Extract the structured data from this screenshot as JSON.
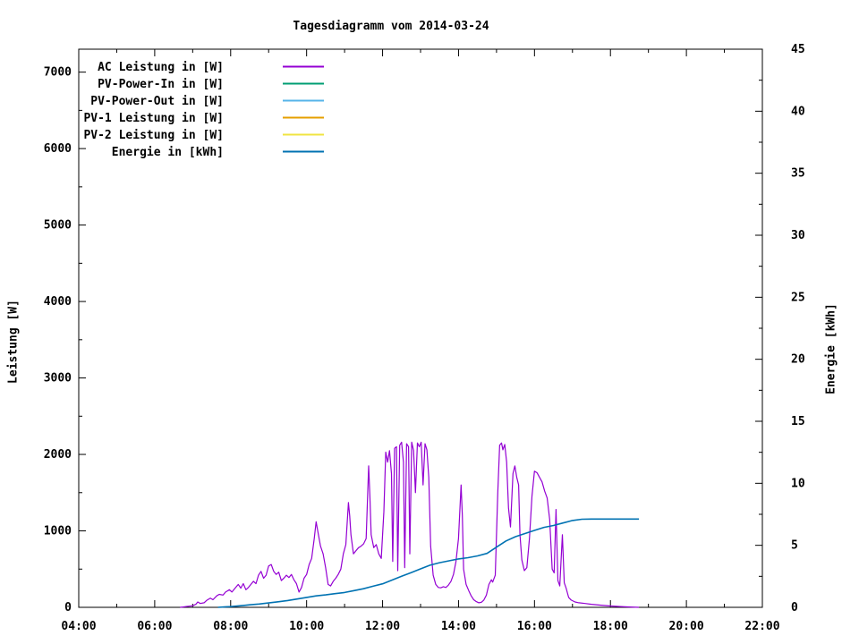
{
  "chart_data": {
    "type": "line",
    "title": "Tagesdiagramm vom 2014-03-24",
    "grid": false,
    "legend_position": "top-left-inside",
    "x_axis": {
      "label": "",
      "range_hours": [
        4,
        22
      ],
      "major_tick_labels": [
        "04:00",
        "06:00",
        "08:00",
        "10:00",
        "12:00",
        "14:00",
        "16:00",
        "18:00",
        "20:00",
        "22:00"
      ],
      "minor_every_hours": 1
    },
    "y_left": {
      "label": "Leistung [W]",
      "range": [
        0,
        7300
      ],
      "ticks": [
        0,
        1000,
        2000,
        3000,
        4000,
        5000,
        6000,
        7000
      ],
      "minor_step": 500
    },
    "y_right": {
      "label": "Energie [kWh]",
      "range": [
        0,
        45
      ],
      "ticks": [
        0,
        5,
        10,
        15,
        20,
        25,
        30,
        35,
        40,
        45
      ],
      "minor_step": 2.5
    },
    "legend": [
      {
        "label": "AC Leistung in [W]",
        "color": "#9400d3"
      },
      {
        "label": "PV-Power-In in [W]",
        "color": "#009e73"
      },
      {
        "label": "PV-Power-Out in [W]",
        "color": "#56b4e9"
      },
      {
        "label": "PV-1 Leistung in [W]",
        "color": "#e69f00"
      },
      {
        "label": "PV-2 Leistung in [W]",
        "color": "#f0e442"
      },
      {
        "label": "Energie in [kWh]",
        "color": "#0072b2"
      }
    ],
    "series": [
      {
        "id": "ac-leistung",
        "name": "AC Leistung in [W]",
        "axis": "left",
        "color": "#9400d3",
        "width": 1.2,
        "points": [
          [
            "06:40",
            0
          ],
          [
            "06:45",
            5
          ],
          [
            "06:50",
            10
          ],
          [
            "06:55",
            15
          ],
          [
            "07:00",
            20
          ],
          [
            "07:05",
            40
          ],
          [
            "07:08",
            70
          ],
          [
            "07:12",
            50
          ],
          [
            "07:18",
            60
          ],
          [
            "07:22",
            90
          ],
          [
            "07:28",
            120
          ],
          [
            "07:32",
            100
          ],
          [
            "07:38",
            150
          ],
          [
            "07:42",
            170
          ],
          [
            "07:48",
            160
          ],
          [
            "07:52",
            200
          ],
          [
            "07:58",
            230
          ],
          [
            "08:02",
            200
          ],
          [
            "08:08",
            260
          ],
          [
            "08:12",
            300
          ],
          [
            "08:16",
            250
          ],
          [
            "08:20",
            310
          ],
          [
            "08:24",
            230
          ],
          [
            "08:28",
            260
          ],
          [
            "08:32",
            300
          ],
          [
            "08:36",
            340
          ],
          [
            "08:40",
            310
          ],
          [
            "08:44",
            420
          ],
          [
            "08:48",
            470
          ],
          [
            "08:52",
            380
          ],
          [
            "08:56",
            420
          ],
          [
            "09:00",
            540
          ],
          [
            "09:04",
            560
          ],
          [
            "09:08",
            470
          ],
          [
            "09:12",
            430
          ],
          [
            "09:16",
            460
          ],
          [
            "09:20",
            350
          ],
          [
            "09:24",
            380
          ],
          [
            "09:28",
            420
          ],
          [
            "09:32",
            390
          ],
          [
            "09:36",
            430
          ],
          [
            "09:40",
            360
          ],
          [
            "09:44",
            310
          ],
          [
            "09:48",
            200
          ],
          [
            "09:52",
            260
          ],
          [
            "09:56",
            380
          ],
          [
            "10:00",
            430
          ],
          [
            "10:04",
            560
          ],
          [
            "10:08",
            640
          ],
          [
            "10:12",
            900
          ],
          [
            "10:15",
            1120
          ],
          [
            "10:18",
            980
          ],
          [
            "10:22",
            800
          ],
          [
            "10:26",
            700
          ],
          [
            "10:30",
            520
          ],
          [
            "10:34",
            300
          ],
          [
            "10:38",
            280
          ],
          [
            "10:42",
            340
          ],
          [
            "10:46",
            380
          ],
          [
            "10:50",
            430
          ],
          [
            "10:54",
            500
          ],
          [
            "10:58",
            700
          ],
          [
            "11:02",
            820
          ],
          [
            "11:06",
            1370
          ],
          [
            "11:08",
            1200
          ],
          [
            "11:10",
            950
          ],
          [
            "11:14",
            700
          ],
          [
            "11:18",
            740
          ],
          [
            "11:22",
            780
          ],
          [
            "11:26",
            800
          ],
          [
            "11:30",
            830
          ],
          [
            "11:34",
            900
          ],
          [
            "11:38",
            1850
          ],
          [
            "11:40",
            1450
          ],
          [
            "11:42",
            950
          ],
          [
            "11:46",
            780
          ],
          [
            "11:50",
            820
          ],
          [
            "11:54",
            700
          ],
          [
            "11:58",
            640
          ],
          [
            "12:02",
            1250
          ],
          [
            "12:05",
            2030
          ],
          [
            "12:08",
            1900
          ],
          [
            "12:11",
            2050
          ],
          [
            "12:14",
            1750
          ],
          [
            "12:16",
            600
          ],
          [
            "12:19",
            2080
          ],
          [
            "12:22",
            2100
          ],
          [
            "12:24",
            480
          ],
          [
            "12:27",
            2120
          ],
          [
            "12:30",
            2160
          ],
          [
            "12:33",
            1900
          ],
          [
            "12:35",
            520
          ],
          [
            "12:38",
            2140
          ],
          [
            "12:41",
            2100
          ],
          [
            "12:43",
            700
          ],
          [
            "12:46",
            2160
          ],
          [
            "12:49",
            2050
          ],
          [
            "12:52",
            1500
          ],
          [
            "12:55",
            2150
          ],
          [
            "12:58",
            2100
          ],
          [
            "13:01",
            2160
          ],
          [
            "13:04",
            1600
          ],
          [
            "13:07",
            2140
          ],
          [
            "13:10",
            2060
          ],
          [
            "13:13",
            1700
          ],
          [
            "13:16",
            800
          ],
          [
            "13:20",
            420
          ],
          [
            "13:24",
            300
          ],
          [
            "13:28",
            260
          ],
          [
            "13:32",
            255
          ],
          [
            "13:36",
            270
          ],
          [
            "13:40",
            260
          ],
          [
            "13:44",
            290
          ],
          [
            "13:48",
            340
          ],
          [
            "13:52",
            430
          ],
          [
            "13:56",
            600
          ],
          [
            "14:00",
            900
          ],
          [
            "14:04",
            1600
          ],
          [
            "14:06",
            1200
          ],
          [
            "14:08",
            500
          ],
          [
            "14:12",
            300
          ],
          [
            "14:16",
            220
          ],
          [
            "14:20",
            150
          ],
          [
            "14:24",
            100
          ],
          [
            "14:28",
            75
          ],
          [
            "14:32",
            60
          ],
          [
            "14:36",
            65
          ],
          [
            "14:40",
            95
          ],
          [
            "14:44",
            160
          ],
          [
            "14:48",
            300
          ],
          [
            "14:52",
            360
          ],
          [
            "14:54",
            330
          ],
          [
            "14:58",
            420
          ],
          [
            "15:02",
            1500
          ],
          [
            "15:05",
            2120
          ],
          [
            "15:08",
            2150
          ],
          [
            "15:10",
            2060
          ],
          [
            "15:13",
            2130
          ],
          [
            "15:16",
            1900
          ],
          [
            "15:19",
            1300
          ],
          [
            "15:22",
            1050
          ],
          [
            "15:26",
            1750
          ],
          [
            "15:29",
            1850
          ],
          [
            "15:32",
            1700
          ],
          [
            "15:35",
            1600
          ],
          [
            "15:37",
            950
          ],
          [
            "15:40",
            620
          ],
          [
            "15:44",
            480
          ],
          [
            "15:48",
            520
          ],
          [
            "15:52",
            900
          ],
          [
            "15:56",
            1450
          ],
          [
            "16:00",
            1780
          ],
          [
            "16:04",
            1760
          ],
          [
            "16:08",
            1700
          ],
          [
            "16:12",
            1640
          ],
          [
            "16:16",
            1520
          ],
          [
            "16:20",
            1430
          ],
          [
            "16:24",
            1150
          ],
          [
            "16:28",
            500
          ],
          [
            "16:31",
            450
          ],
          [
            "16:34",
            1280
          ],
          [
            "16:37",
            350
          ],
          [
            "16:40",
            280
          ],
          [
            "16:44",
            950
          ],
          [
            "16:47",
            320
          ],
          [
            "16:50",
            250
          ],
          [
            "16:54",
            130
          ],
          [
            "16:58",
            95
          ],
          [
            "17:04",
            70
          ],
          [
            "17:10",
            60
          ],
          [
            "17:20",
            50
          ],
          [
            "17:30",
            40
          ],
          [
            "17:45",
            28
          ],
          [
            "18:00",
            18
          ],
          [
            "18:15",
            10
          ],
          [
            "18:30",
            5
          ],
          [
            "18:45",
            0
          ]
        ]
      },
      {
        "id": "pv-power-in",
        "name": "PV-Power-In in [W]",
        "axis": "left",
        "color": "#009e73",
        "width": 1.2,
        "points": []
      },
      {
        "id": "pv-power-out",
        "name": "PV-Power-Out in [W]",
        "axis": "left",
        "color": "#56b4e9",
        "width": 1.2,
        "points": []
      },
      {
        "id": "pv-1-leistung",
        "name": "PV-1 Leistung in [W]",
        "axis": "left",
        "color": "#e69f00",
        "width": 1.2,
        "points": []
      },
      {
        "id": "pv-2-leistung",
        "name": "PV-2 Leistung in [W]",
        "axis": "left",
        "color": "#f0e442",
        "width": 1.2,
        "points": []
      },
      {
        "id": "energie",
        "name": "Energie in [kWh]",
        "axis": "right",
        "color": "#0072b2",
        "width": 1.6,
        "points": [
          [
            "07:40",
            0
          ],
          [
            "07:50",
            0.03
          ],
          [
            "08:00",
            0.06
          ],
          [
            "08:10",
            0.1
          ],
          [
            "08:20",
            0.15
          ],
          [
            "08:30",
            0.2
          ],
          [
            "08:45",
            0.27
          ],
          [
            "09:00",
            0.35
          ],
          [
            "09:15",
            0.45
          ],
          [
            "09:30",
            0.55
          ],
          [
            "09:45",
            0.67
          ],
          [
            "10:00",
            0.8
          ],
          [
            "10:15",
            0.92
          ],
          [
            "10:30",
            1.0
          ],
          [
            "10:45",
            1.1
          ],
          [
            "11:00",
            1.2
          ],
          [
            "11:15",
            1.35
          ],
          [
            "11:30",
            1.5
          ],
          [
            "11:45",
            1.7
          ],
          [
            "12:00",
            1.9
          ],
          [
            "12:15",
            2.2
          ],
          [
            "12:30",
            2.5
          ],
          [
            "12:45",
            2.8
          ],
          [
            "13:00",
            3.1
          ],
          [
            "13:15",
            3.4
          ],
          [
            "13:30",
            3.6
          ],
          [
            "13:45",
            3.75
          ],
          [
            "14:00",
            3.9
          ],
          [
            "14:15",
            4.0
          ],
          [
            "14:30",
            4.15
          ],
          [
            "14:45",
            4.35
          ],
          [
            "15:00",
            4.85
          ],
          [
            "15:15",
            5.35
          ],
          [
            "15:30",
            5.7
          ],
          [
            "15:45",
            5.95
          ],
          [
            "16:00",
            6.2
          ],
          [
            "16:15",
            6.45
          ],
          [
            "16:30",
            6.6
          ],
          [
            "16:45",
            6.8
          ],
          [
            "17:00",
            7.0
          ],
          [
            "17:15",
            7.1
          ],
          [
            "17:30",
            7.12
          ],
          [
            "18:00",
            7.12
          ],
          [
            "18:45",
            7.12
          ]
        ]
      }
    ]
  }
}
